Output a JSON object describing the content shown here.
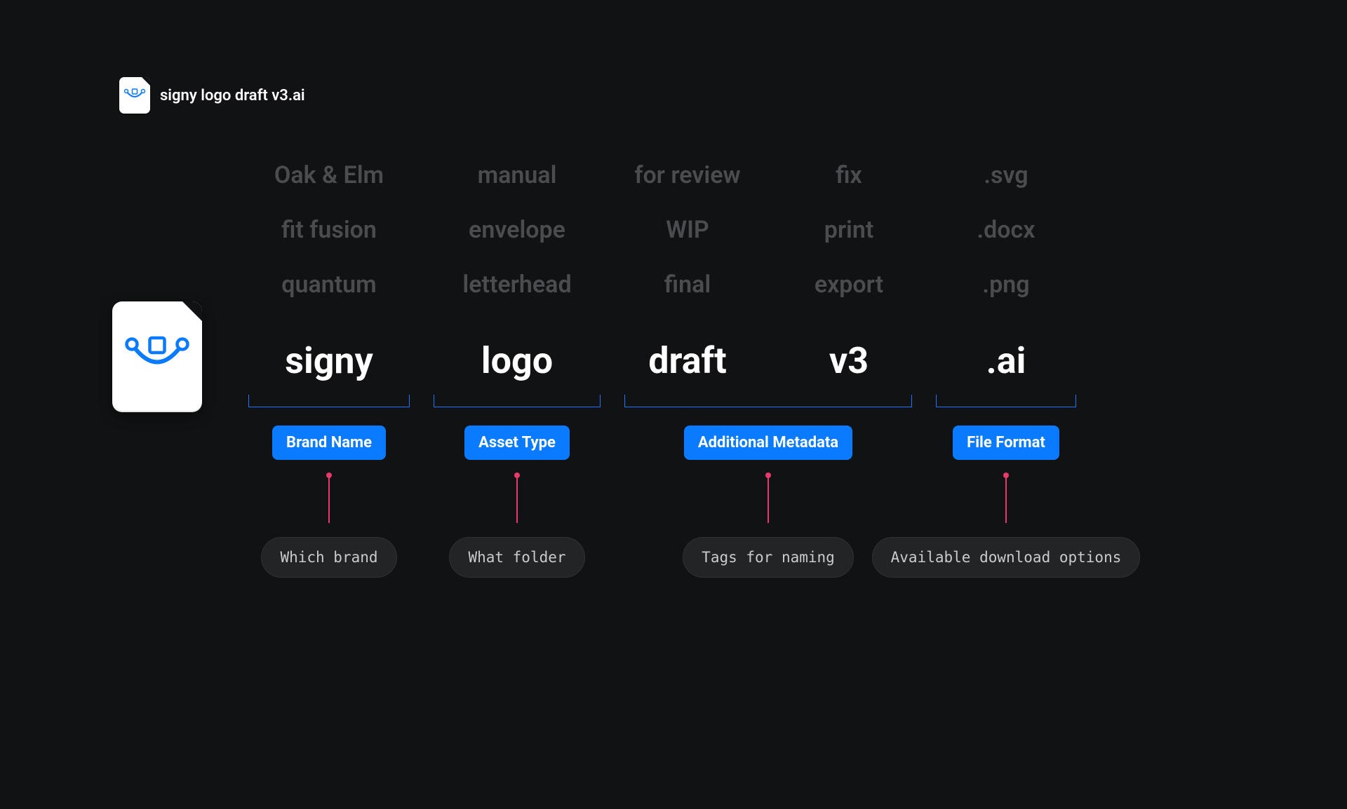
{
  "file": {
    "name": "signy logo draft v3.ai"
  },
  "columns": {
    "brand": {
      "alts": [
        "Oak & Elm",
        "fit fusion",
        "quantum"
      ],
      "current": "signy",
      "badge": "Brand Name",
      "explain": "Which brand"
    },
    "asset": {
      "alts": [
        "manual",
        "envelope",
        "letterhead"
      ],
      "current": "logo",
      "badge": "Asset Type",
      "explain": "What folder"
    },
    "meta": {
      "left": {
        "alts": [
          "for review",
          "WIP",
          "final"
        ],
        "current": "draft"
      },
      "right": {
        "alts": [
          "fix",
          "print",
          "export"
        ],
        "current": "v3"
      },
      "badge": "Additional Metadata",
      "explain": "Tags for naming"
    },
    "format": {
      "alts": [
        ".svg",
        ".docx",
        ".png"
      ],
      "current": ".ai",
      "badge": "File Format",
      "explain": "Available download options"
    }
  },
  "colors": {
    "accent": "#0a7bff",
    "connector": "#e83a6b",
    "ghost": "#4a4c4f"
  }
}
